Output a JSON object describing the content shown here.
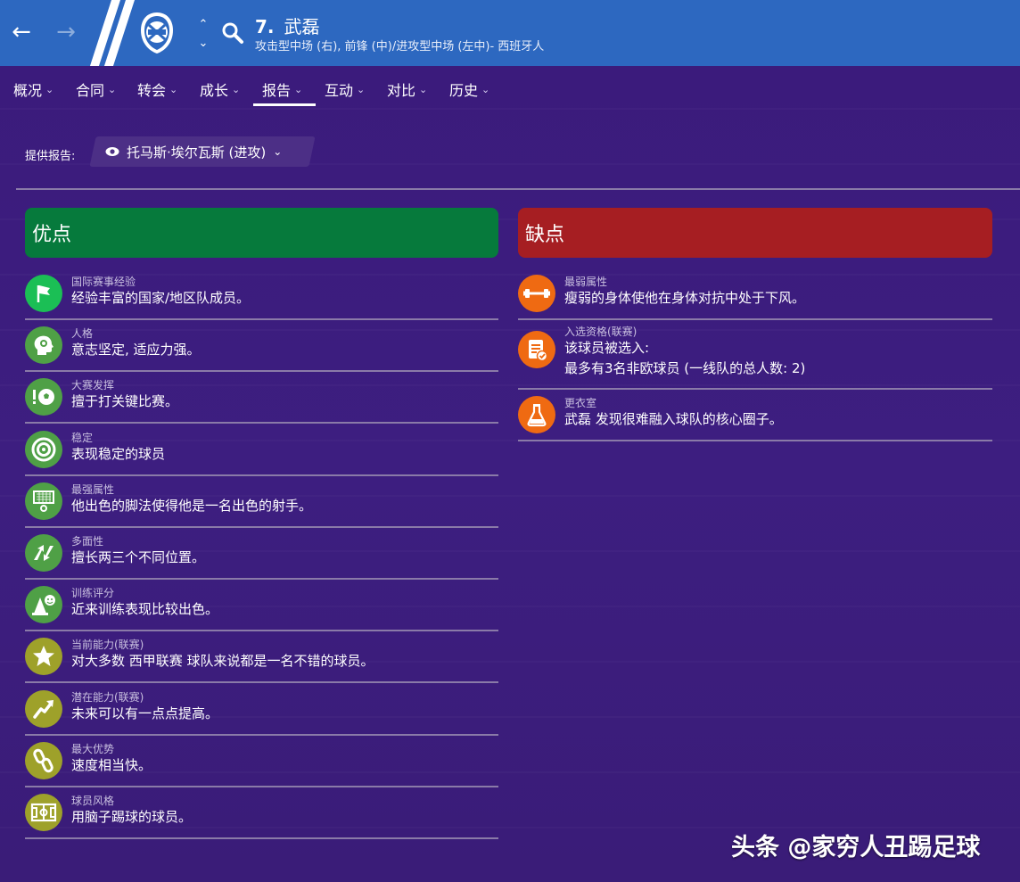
{
  "header": {
    "player_number": "7.",
    "player_name": "武磊",
    "player_positions": "攻击型中场 (右), 前锋 (中)/进攻型中场 (左中)- 西班牙人",
    "header_color": "#2d68c0"
  },
  "tabs": [
    {
      "label": "概况"
    },
    {
      "label": "合同"
    },
    {
      "label": "转会"
    },
    {
      "label": "成长"
    },
    {
      "label": "报告",
      "active": true
    },
    {
      "label": "互动"
    },
    {
      "label": "对比"
    },
    {
      "label": "历史"
    }
  ],
  "report": {
    "label": "提供报告:",
    "scout": "托马斯·埃尔瓦斯 (进攻)"
  },
  "strengths": {
    "title": "优点",
    "color": "#067a3c",
    "items": [
      {
        "category": "国际赛事经验",
        "text": "经验丰富的国家/地区队成员。",
        "icon": "flag-icon"
      },
      {
        "category": "人格",
        "text": "意志坚定, 适应力强。",
        "icon": "head-icon"
      },
      {
        "category": "大赛发挥",
        "text": "擅于打关键比赛。",
        "icon": "ball-alert-icon"
      },
      {
        "category": "稳定",
        "text": "表现稳定的球员",
        "icon": "target-icon"
      },
      {
        "category": "最强属性",
        "text": "他出色的脚法使得他是一名出色的射手。",
        "icon": "goal-icon"
      },
      {
        "category": "多面性",
        "text": "擅长两三个不同位置。",
        "icon": "swap-arrows-icon"
      },
      {
        "category": "训练评分",
        "text": "近来训练表现比较出色。",
        "icon": "training-cone-icon"
      },
      {
        "category": "当前能力(联赛)",
        "text": "对大多数 西甲联赛 球队来说都是一名不错的球员。",
        "icon": "star-icon"
      },
      {
        "category": "潜在能力(联赛)",
        "text": "未来可以有一点点提高。",
        "icon": "trend-up-icon"
      },
      {
        "category": "最大优势",
        "text": "速度相当快。",
        "icon": "chain-icon"
      },
      {
        "category": "球员风格",
        "text": "用脑子踢球的球员。",
        "icon": "pitch-icon"
      }
    ]
  },
  "weaknesses": {
    "title": "缺点",
    "color": "#a61e22",
    "items": [
      {
        "category": "最弱属性",
        "text": "瘦弱的身体使他在身体对抗中处于下风。",
        "icon": "dumbbell-icon"
      },
      {
        "category": "入选资格(联赛)",
        "text": "该球员被选入:",
        "text2": "最多有3名非欧球员 (一线队的总人数: 2)",
        "icon": "document-check-icon"
      },
      {
        "category": "更衣室",
        "text": "武磊 发现很难融入球队的核心圈子。",
        "icon": "flask-icon"
      }
    ]
  },
  "watermark": "头条 @家穷人丑踢足球"
}
